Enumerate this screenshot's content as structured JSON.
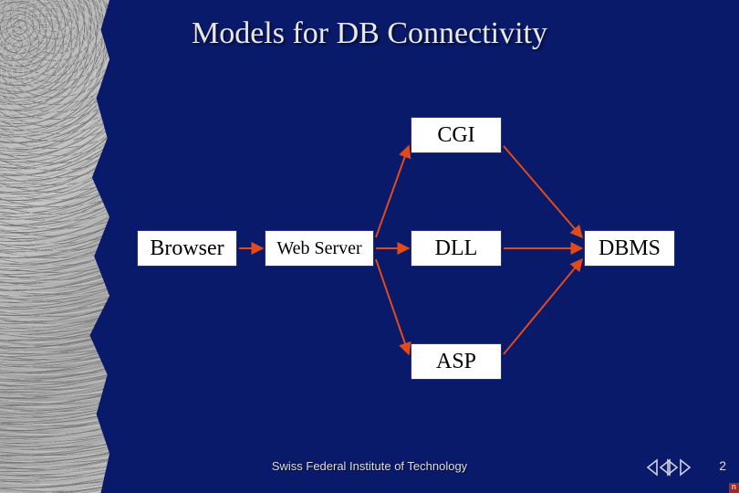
{
  "title": "Models for DB Connectivity",
  "nodes": {
    "browser": {
      "label": "Browser"
    },
    "webserver": {
      "label": "Web Server"
    },
    "cgi": {
      "label": "CGI"
    },
    "dll": {
      "label": "DLL"
    },
    "asp": {
      "label": "ASP"
    },
    "dbms": {
      "label": "DBMS"
    }
  },
  "footer": "Swiss Federal Institute of Technology",
  "slide_number": "2",
  "corner_badge": "n",
  "colors": {
    "background": "#0a1a6b",
    "node_bg": "#ffffff",
    "node_border": "#2a2a8a",
    "arrow": "#e34a1a"
  }
}
